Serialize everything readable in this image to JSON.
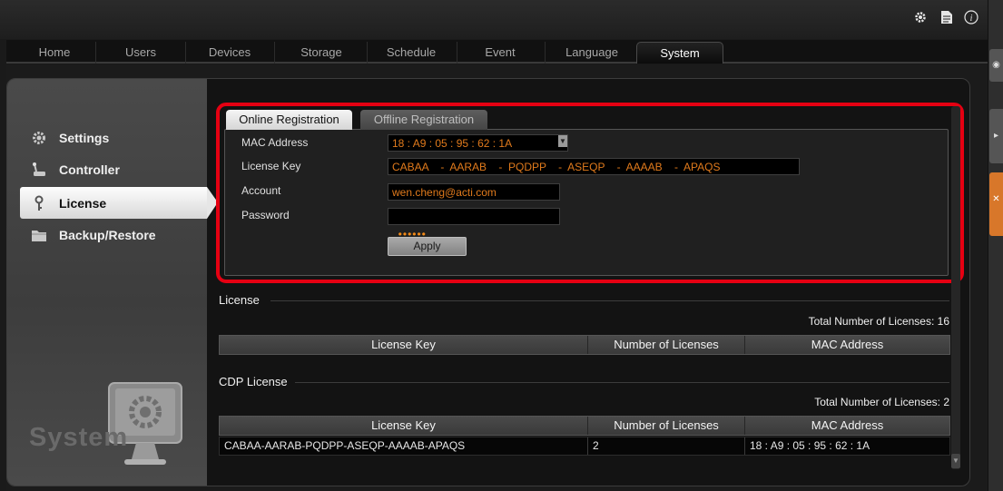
{
  "top_icons": [
    "gear-icon",
    "document-icon",
    "info-icon"
  ],
  "tabs": [
    {
      "label": "Home",
      "active": false
    },
    {
      "label": "Users",
      "active": false
    },
    {
      "label": "Devices",
      "active": false
    },
    {
      "label": "Storage",
      "active": false
    },
    {
      "label": "Schedule",
      "active": false
    },
    {
      "label": "Event",
      "active": false
    },
    {
      "label": "Language",
      "active": false
    },
    {
      "label": "System",
      "active": true
    }
  ],
  "sidebar": {
    "items": [
      {
        "label": "Settings",
        "icon": "gear-icon",
        "active": false
      },
      {
        "label": "Controller",
        "icon": "joystick-icon",
        "active": false
      },
      {
        "label": "License",
        "icon": "key-icon",
        "active": true
      },
      {
        "label": "Backup/Restore",
        "icon": "folder-icon",
        "active": false
      }
    ],
    "footer_label": "System",
    "footer_icon": "monitor-gear-icon"
  },
  "registration": {
    "tabs": [
      {
        "label": "Online Registration",
        "active": true
      },
      {
        "label": "Offline Registration",
        "active": false
      }
    ],
    "fields": {
      "mac_label": "MAC Address",
      "mac_value": "18 : A9 : 05 : 95 : 62 : 1A",
      "license_label": "License Key",
      "license_value": "CABAA    -  AARAB    -  PQDPP    -  ASEQP    -  AAAAB    -  APAQS",
      "account_label": "Account",
      "account_value": "wen.cheng@acti.com",
      "password_label": "Password",
      "password_value": "••••••"
    },
    "apply_label": "Apply"
  },
  "license_section": {
    "title": "License",
    "total": "Total Number of Licenses: 16",
    "columns": [
      "License Key",
      "Number of Licenses",
      "MAC Address"
    ],
    "rows": []
  },
  "cdp_section": {
    "title": "CDP License",
    "total": "Total Number of Licenses: 2",
    "columns": [
      "License Key",
      "Number of Licenses",
      "MAC Address"
    ],
    "rows": [
      {
        "key": "CABAA-AARAB-PQDPP-ASEQP-AAAAB-APAQS",
        "count": "2",
        "mac": "18 : A9 : 05 : 95 : 62 : 1A"
      }
    ]
  },
  "colors": {
    "highlight": "#e50012",
    "field_text": "#e07a1c"
  }
}
